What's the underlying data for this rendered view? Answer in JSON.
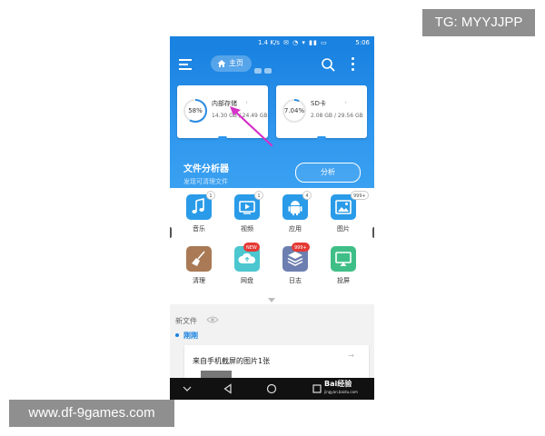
{
  "watermarks": {
    "top": "TG: MYYJJPP",
    "bottom": "www.df-9games.com"
  },
  "status_bar": {
    "speed": "1.4 K/s",
    "battery_time": "5:06"
  },
  "header": {
    "home_tab_label": "主页"
  },
  "storage": {
    "internal": {
      "percent_label": "58%",
      "percent_value": 0.58,
      "name": "内部存储",
      "size": "14.30 GB / 24.49 GB"
    },
    "sd": {
      "percent_label": "7.04%",
      "percent_value": 0.0704,
      "name": "SD卡",
      "size": "2.08 GB / 29.56 GB"
    }
  },
  "analyzer": {
    "title": "文件分析器",
    "subtitle": "发现可清理文件",
    "button": "分析"
  },
  "categories": [
    {
      "label": "音乐",
      "badge": "1",
      "icon": "music-icon",
      "color": "#2a9be8"
    },
    {
      "label": "视频",
      "badge": "1",
      "icon": "video-icon",
      "color": "#2a9be8"
    },
    {
      "label": "应用",
      "badge": "4",
      "icon": "android-icon",
      "color": "#2a9be8"
    },
    {
      "label": "图片",
      "badge": "999+",
      "icon": "image-icon",
      "color": "#2a9be8"
    },
    {
      "label": "清理",
      "badge": "",
      "icon": "broom-icon",
      "color": "#a97a55"
    },
    {
      "label": "网盘",
      "badge": "NEW",
      "icon": "cloud-icon",
      "color": "#4cc6cf"
    },
    {
      "label": "日志",
      "badge": "999+",
      "icon": "log-icon",
      "color": "#6d7fb0"
    },
    {
      "label": "投屏",
      "badge": "",
      "icon": "cast-icon",
      "color": "#3fbf87"
    }
  ],
  "recent": {
    "heading": "新文件",
    "section": "刚刚",
    "item_title": "来自手机截屏的图片1张"
  },
  "navbar": {
    "brand": "Bai经验",
    "url": "jingyan.baidu.com"
  }
}
